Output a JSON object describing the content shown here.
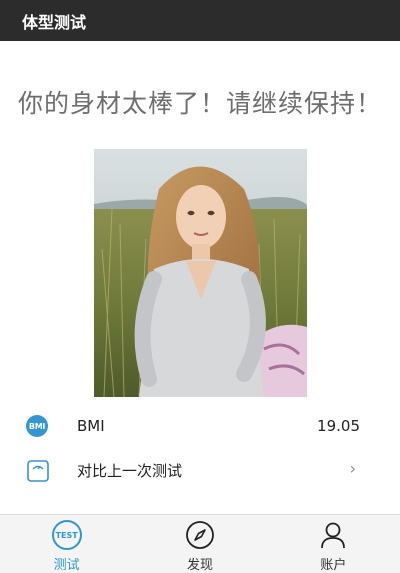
{
  "window": {
    "title": "体型测试"
  },
  "result": {
    "headline": "你的身材太棒了！请继续保持！"
  },
  "photo": {
    "alt_icon": "portrait-photo"
  },
  "rows": {
    "bmi": {
      "icon": "bmi-icon",
      "badge": "BMI",
      "label": "BMI",
      "value": "19.05"
    },
    "compare": {
      "icon": "scale-icon",
      "label": "对比上一次测试",
      "chevron": "›"
    }
  },
  "tabbar": {
    "tabs": [
      {
        "label": "测试",
        "icon": "test-icon",
        "badge": "TEST",
        "active": true
      },
      {
        "label": "发现",
        "icon": "compass-icon",
        "active": false
      },
      {
        "label": "账户",
        "icon": "user-icon",
        "active": false
      }
    ]
  },
  "colors": {
    "accent": "#2f96d2",
    "titlebar": "#2c2c2c",
    "headline": "#6e6e6e"
  }
}
